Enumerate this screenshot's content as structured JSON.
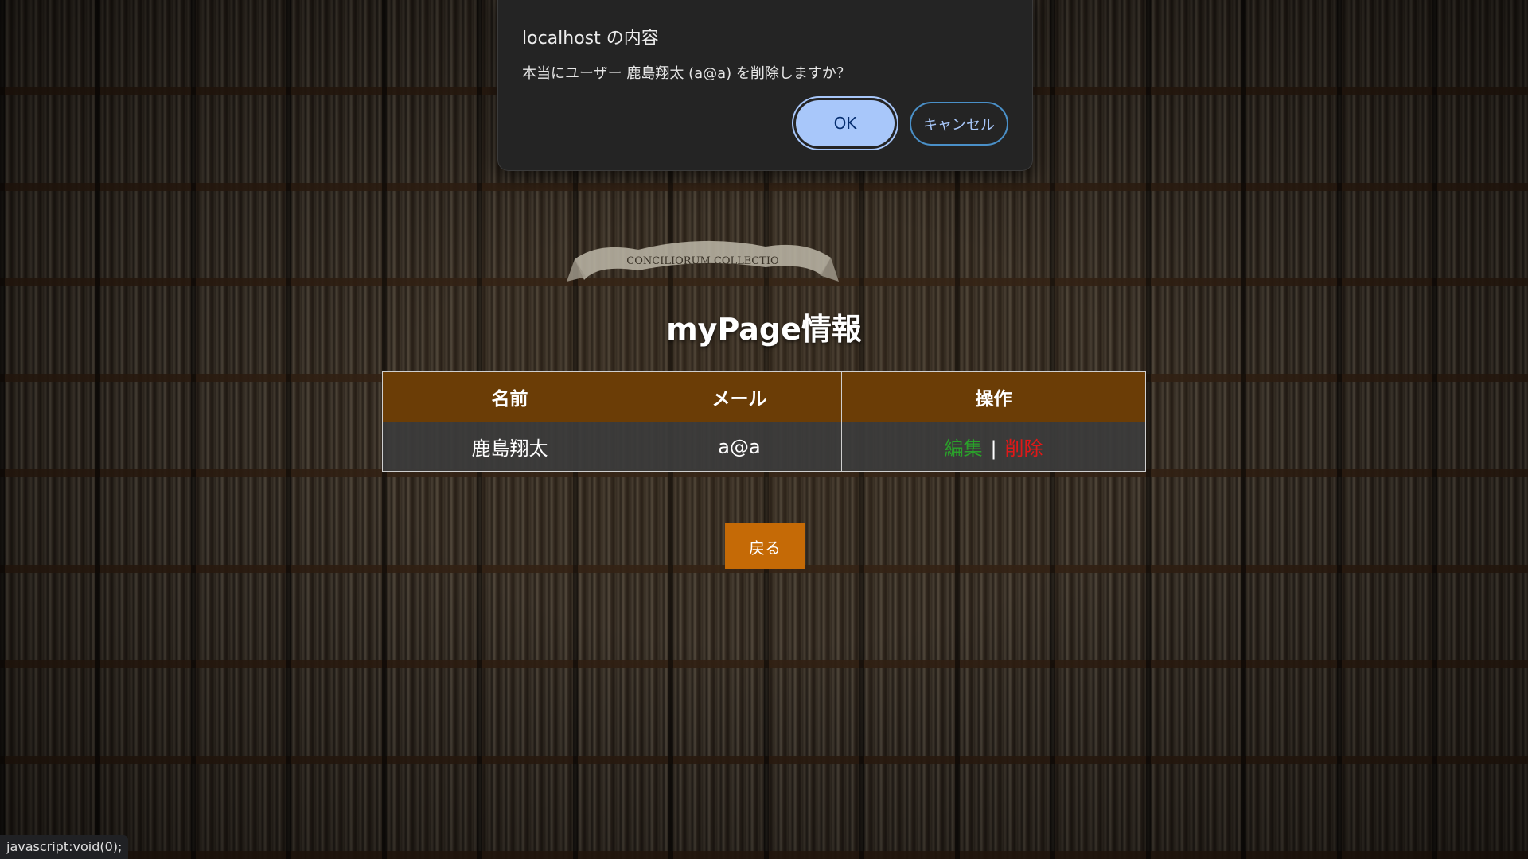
{
  "dialog": {
    "title": "localhost の内容",
    "message": "本当にユーザー 鹿島翔太 (a@a) を削除しますか？",
    "ok_label": "OK",
    "cancel_label": "キャンセル"
  },
  "page": {
    "title": "myPage情報",
    "back_label": "戻る"
  },
  "table": {
    "headers": [
      "名前",
      "メール",
      "操作"
    ],
    "rows": [
      {
        "name": "鹿島翔太",
        "email": "a@a",
        "edit_label": "編集",
        "separator": "|",
        "delete_label": "削除"
      }
    ]
  },
  "banner_text": "CONCILIORUM COLLECTIO",
  "status_bar": {
    "text": "javascript:void(0);"
  },
  "colors": {
    "header_bg": "#6b3d06",
    "back_button": "#c56a06",
    "edit_link": "#2aa12a",
    "delete_link": "#e01818",
    "ok_button": "#a8c7fa",
    "dialog_bg": "#242424"
  }
}
